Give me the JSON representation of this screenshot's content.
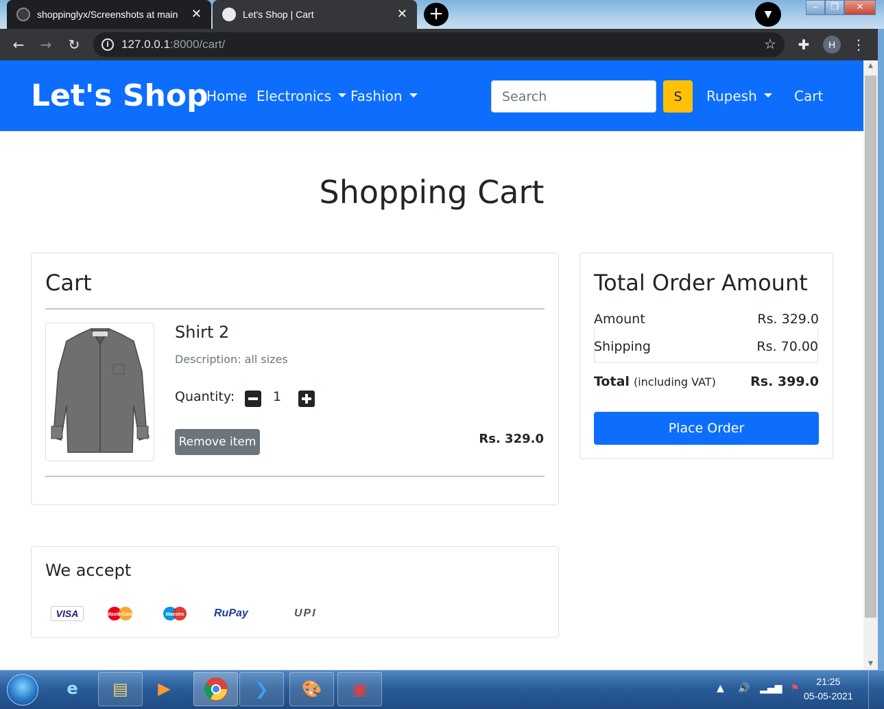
{
  "browser": {
    "tabs": [
      {
        "title": "shoppinglyx/Screenshots at main",
        "active": false
      },
      {
        "title": "Let's Shop | Cart",
        "active": true
      }
    ],
    "new_tab_label": "+",
    "close_glyph": "✕",
    "url_host": "127.0.0.1",
    "url_rest": ":8000/cart/",
    "profile_initial": "H",
    "icons": [
      "back-arrow-icon",
      "forward-arrow-icon",
      "reload-icon",
      "site-info-icon",
      "bookmark-star-icon",
      "extensions-puzzle-icon",
      "kebab-menu-icon"
    ]
  },
  "navbar": {
    "brand": "Let's Shop",
    "links": {
      "home": "Home",
      "electronics": "Electronics",
      "fashion": "Fashion",
      "user": "Rupesh",
      "cart": "Cart"
    },
    "search_placeholder": "Search",
    "search_button": "S",
    "color": "#0d6efd",
    "search_button_color": "#ffc107"
  },
  "page": {
    "title": "Shopping Cart"
  },
  "cart": {
    "heading": "Cart",
    "items": [
      {
        "name": "Shirt 2",
        "description": "Description: all sizes",
        "quantity_label": "Quantity:",
        "quantity": "1",
        "remove_label": "Remove item",
        "price": "Rs. 329.0",
        "image": "grey-shirt"
      }
    ]
  },
  "order_summary": {
    "heading": "Total Order Amount",
    "amount_label": "Amount",
    "amount_value": "Rs. 329.0",
    "shipping_label": "Shipping",
    "shipping_value": "Rs. 70.00",
    "total_label": "Total",
    "total_note": "(including VAT)",
    "total_value": "Rs. 399.0",
    "place_order_label": "Place Order"
  },
  "payments": {
    "heading": "We accept",
    "methods": [
      "VISA",
      "MasterCard",
      "Maestro",
      "RuPay",
      "UPI"
    ]
  },
  "taskbar": {
    "time": "21:25",
    "date": "05-05-2021",
    "apps": [
      "internet-explorer",
      "file-explorer",
      "media-player",
      "chrome",
      "vscode",
      "paint",
      "screen-capture"
    ]
  }
}
